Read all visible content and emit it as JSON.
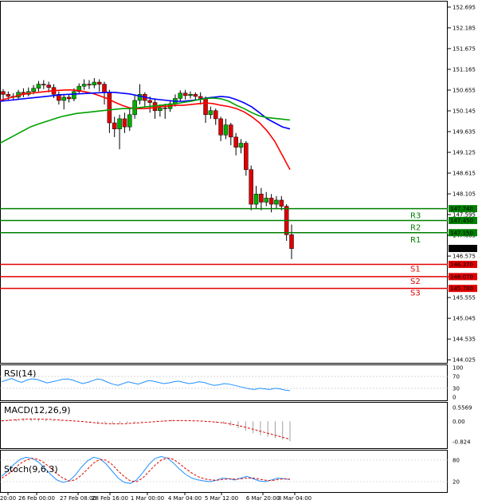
{
  "chart_data": {
    "type": "candlestick",
    "main": {
      "price_ticks": [
        "152.695",
        "152.185",
        "151.675",
        "151.165",
        "150.655",
        "150.145",
        "149.635",
        "149.125",
        "148.615",
        "148.105",
        "147.595",
        "147.085",
        "146.575",
        "146.065",
        "145.555",
        "145.045",
        "144.535",
        "144.025"
      ],
      "price_tick_values": [
        152.695,
        152.185,
        151.675,
        151.165,
        150.655,
        150.145,
        149.635,
        149.125,
        148.615,
        148.105,
        147.595,
        147.085,
        146.575,
        146.065,
        145.555,
        145.045,
        144.535,
        144.025
      ],
      "ylim": [
        143.95,
        152.85
      ],
      "current_price": "146.762",
      "current_price_value": 146.762,
      "x_ticks": [
        "20:00",
        "26 Feb 00:00",
        "27 Feb 08:00",
        "28 Feb 16:00",
        "1 Mar 00:00",
        "4 Mar 04:00",
        "5 Mar 12:00",
        "6 Mar 20:00",
        "8 Mar 04:00"
      ],
      "levels": [
        {
          "name": "R3",
          "label": "147.740",
          "value": 147.74,
          "color": "#008000"
        },
        {
          "name": "R2",
          "label": "147.450",
          "value": 147.45,
          "color": "#008000"
        },
        {
          "name": "R1",
          "label": "147.150",
          "value": 147.15,
          "color": "#008000"
        },
        {
          "name": "S1",
          "label": "146.370",
          "value": 146.37,
          "color": "#e00000"
        },
        {
          "name": "S2",
          "label": "146.070",
          "value": 146.07,
          "color": "#e00000"
        },
        {
          "name": "S3",
          "label": "145.780",
          "value": 145.78,
          "color": "#e00000"
        }
      ],
      "level_names": {
        "R3": "R3",
        "R2": "R2",
        "R1": "R1",
        "S1": "S1",
        "S2": "S2",
        "S3": "S3"
      },
      "candles": [
        [
          150.62,
          150.55,
          150.68,
          150.4
        ],
        [
          150.55,
          150.5,
          150.62,
          150.42
        ],
        [
          150.5,
          150.48,
          150.58,
          150.4
        ],
        [
          150.48,
          150.6,
          150.66,
          150.42
        ],
        [
          150.6,
          150.55,
          150.7,
          150.48
        ],
        [
          150.55,
          150.62,
          150.72,
          150.5
        ],
        [
          150.62,
          150.7,
          150.78,
          150.55
        ],
        [
          150.7,
          150.8,
          150.88,
          150.62
        ],
        [
          150.8,
          150.78,
          150.9,
          150.68
        ],
        [
          150.78,
          150.72,
          150.86,
          150.6
        ],
        [
          150.72,
          150.55,
          150.8,
          150.46
        ],
        [
          150.55,
          150.4,
          150.62,
          150.3
        ],
        [
          150.4,
          150.48,
          150.56,
          150.18
        ],
        [
          150.48,
          150.44,
          150.56,
          150.35
        ],
        [
          150.44,
          150.62,
          150.7,
          150.38
        ],
        [
          150.62,
          150.75,
          150.82,
          150.55
        ],
        [
          150.75,
          150.8,
          150.92,
          150.66
        ],
        [
          150.8,
          150.78,
          150.9,
          150.68
        ],
        [
          150.78,
          150.85,
          150.95,
          150.7
        ],
        [
          150.85,
          150.8,
          150.92,
          150.62
        ],
        [
          150.8,
          150.6,
          150.86,
          150.3
        ],
        [
          150.6,
          149.85,
          150.66,
          149.6
        ],
        [
          149.85,
          149.7,
          150.0,
          149.5
        ],
        [
          149.7,
          149.95,
          150.05,
          149.2
        ],
        [
          149.95,
          149.75,
          150.1,
          149.6
        ],
        [
          149.75,
          150.05,
          150.2,
          149.65
        ],
        [
          150.05,
          150.4,
          150.55,
          149.95
        ],
        [
          150.4,
          150.55,
          150.8,
          150.3
        ],
        [
          150.55,
          150.4,
          150.6,
          150.25
        ],
        [
          150.4,
          150.35,
          150.5,
          150.1
        ],
        [
          150.35,
          150.15,
          150.45,
          149.95
        ],
        [
          150.15,
          150.22,
          150.3,
          150.0
        ],
        [
          150.22,
          150.2,
          150.32,
          149.95
        ],
        [
          150.2,
          150.32,
          150.4,
          150.12
        ],
        [
          150.32,
          150.45,
          150.55,
          150.25
        ],
        [
          150.45,
          150.58,
          150.65,
          150.38
        ],
        [
          150.58,
          150.52,
          150.66,
          150.42
        ],
        [
          150.52,
          150.55,
          150.62,
          150.45
        ],
        [
          150.55,
          150.5,
          150.6,
          150.4
        ],
        [
          150.5,
          150.45,
          150.6,
          150.3
        ],
        [
          150.45,
          150.05,
          150.5,
          149.85
        ],
        [
          150.05,
          150.15,
          150.25,
          149.95
        ],
        [
          150.15,
          149.95,
          150.2,
          149.8
        ],
        [
          149.95,
          149.55,
          150.0,
          149.4
        ],
        [
          149.55,
          149.8,
          149.95,
          149.45
        ],
        [
          149.8,
          149.5,
          149.85,
          149.3
        ],
        [
          149.5,
          149.25,
          149.6,
          149.05
        ],
        [
          149.25,
          149.35,
          149.45,
          149.1
        ],
        [
          149.35,
          148.7,
          149.4,
          148.55
        ],
        [
          148.7,
          147.85,
          148.8,
          147.7
        ],
        [
          147.85,
          148.1,
          148.3,
          147.75
        ],
        [
          148.1,
          147.9,
          148.25,
          147.7
        ],
        [
          147.9,
          148.0,
          148.15,
          147.8
        ],
        [
          148.0,
          147.85,
          148.1,
          147.65
        ],
        [
          147.85,
          147.95,
          148.05,
          147.75
        ],
        [
          147.95,
          147.8,
          148.05,
          147.7
        ],
        [
          147.8,
          147.1,
          147.85,
          146.95
        ],
        [
          147.1,
          146.76,
          147.35,
          146.5
        ]
      ],
      "series": [
        {
          "name": "",
          "color": "#ff0000",
          "values": [
            150.4,
            150.45,
            150.5,
            150.55,
            150.58,
            150.6,
            150.62,
            150.64,
            150.65,
            150.66,
            150.65,
            150.62,
            150.58,
            150.52,
            150.45,
            150.36,
            150.28,
            150.22,
            150.2,
            150.2,
            150.22,
            150.25,
            150.26,
            150.28,
            150.28,
            150.3,
            150.32,
            150.34,
            150.32,
            150.28,
            150.25,
            150.2,
            150.12,
            150.0,
            149.85,
            149.65,
            149.4,
            149.05,
            148.7
          ]
        },
        {
          "name": "",
          "color": "#0000ff",
          "values": [
            150.38,
            150.4,
            150.42,
            150.44,
            150.46,
            150.48,
            150.5,
            150.52,
            150.54,
            150.55,
            150.56,
            150.57,
            150.58,
            150.59,
            150.6,
            150.6,
            150.58,
            150.56,
            150.52,
            150.48,
            150.44,
            150.42,
            150.4,
            150.38,
            150.38,
            150.4,
            150.42,
            150.46,
            150.48,
            150.5,
            150.48,
            150.42,
            150.34,
            150.24,
            150.1,
            149.95,
            149.85,
            149.75,
            149.7
          ]
        },
        {
          "name": "",
          "color": "#00a000",
          "values": [
            149.35,
            149.45,
            149.55,
            149.65,
            149.75,
            149.82,
            149.88,
            149.94,
            150.0,
            150.04,
            150.08,
            150.1,
            150.12,
            150.14,
            150.16,
            150.18,
            150.2,
            150.2,
            150.22,
            150.24,
            150.26,
            150.28,
            150.3,
            150.32,
            150.35,
            150.38,
            150.42,
            150.45,
            150.46,
            150.44,
            150.38,
            150.28,
            150.2,
            150.1,
            150.02,
            149.98,
            149.96,
            149.94,
            149.92
          ]
        }
      ]
    },
    "rsi": {
      "label": "RSI(14)",
      "ticks": [
        "100",
        "70",
        "30",
        "0"
      ],
      "tick_values": [
        100,
        70,
        30,
        0
      ],
      "ylim": [
        0,
        100
      ],
      "color": "#1e90ff",
      "values": [
        52,
        58,
        63,
        55,
        50,
        58,
        62,
        60,
        54,
        48,
        52,
        56,
        60,
        62,
        58,
        52,
        46,
        50,
        56,
        62,
        58,
        50,
        44,
        40,
        46,
        52,
        48,
        44,
        50,
        56,
        54,
        50,
        46,
        48,
        52,
        54,
        50,
        46,
        48,
        52,
        50,
        44,
        40,
        42,
        46,
        44,
        40,
        36,
        32,
        28,
        26,
        30,
        28,
        26,
        30,
        28,
        24,
        22
      ]
    },
    "macd": {
      "label": "MACD(12,26,9)",
      "ticks": [
        "0.5569",
        "0.00",
        "-0.824"
      ],
      "tick_values": [
        0.5569,
        0,
        -0.824
      ],
      "ylim": [
        -0.95,
        0.65
      ],
      "signal_color": "#e00000",
      "histogram_color": "#a0a0a0",
      "histogram": [
        0.05,
        0.08,
        0.1,
        0.12,
        0.12,
        0.1,
        0.08,
        0.06,
        0.04,
        0.02,
        0.0,
        -0.02,
        -0.06,
        -0.1,
        -0.12,
        -0.12,
        -0.1,
        -0.08,
        -0.05,
        -0.02,
        0.0,
        0.02,
        0.04,
        0.06,
        0.05,
        0.03,
        0.02,
        0.0,
        -0.02,
        -0.05,
        -0.1,
        -0.18,
        -0.28,
        -0.38,
        -0.48,
        -0.56,
        -0.62,
        -0.68,
        -0.74,
        -0.8
      ],
      "signal": [
        0.02,
        0.04,
        0.06,
        0.08,
        0.09,
        0.09,
        0.08,
        0.07,
        0.05,
        0.03,
        0.01,
        -0.01,
        -0.04,
        -0.07,
        -0.09,
        -0.1,
        -0.1,
        -0.09,
        -0.07,
        -0.05,
        -0.03,
        -0.01,
        0.01,
        0.03,
        0.03,
        0.03,
        0.02,
        0.01,
        -0.01,
        -0.03,
        -0.06,
        -0.11,
        -0.17,
        -0.24,
        -0.32,
        -0.4,
        -0.48,
        -0.56,
        -0.64,
        -0.72
      ]
    },
    "stoch": {
      "label": "Stoch(9,6,3)",
      "ticks": [
        "80",
        "20"
      ],
      "tick_values": [
        80,
        20
      ],
      "ylim": [
        0,
        100
      ],
      "main_color": "#1e90ff",
      "signal_color": "#e00000",
      "main": [
        35,
        50,
        68,
        82,
        88,
        85,
        75,
        58,
        40,
        25,
        18,
        22,
        38,
        60,
        78,
        88,
        84,
        70,
        50,
        30,
        18,
        15,
        25,
        45,
        68,
        85,
        90,
        86,
        72,
        55,
        40,
        30,
        25,
        22,
        20,
        24,
        30,
        28,
        25,
        30,
        35,
        28,
        22,
        20,
        25,
        30,
        28,
        26
      ],
      "signal": [
        30,
        40,
        55,
        70,
        80,
        85,
        82,
        72,
        58,
        42,
        30,
        22,
        25,
        38,
        55,
        72,
        82,
        80,
        68,
        50,
        34,
        22,
        20,
        30,
        48,
        66,
        80,
        86,
        82,
        70,
        56,
        44,
        34,
        28,
        25,
        24,
        26,
        28,
        27,
        28,
        30,
        30,
        27,
        24,
        23,
        26,
        28,
        27
      ]
    }
  }
}
